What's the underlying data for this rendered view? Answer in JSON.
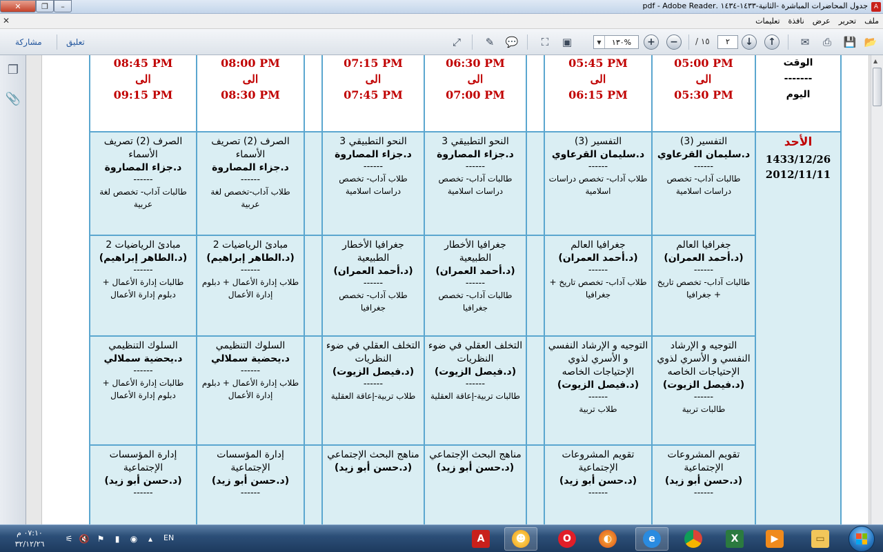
{
  "window": {
    "title": "جدول المحاضرات المباشرة -الثانية-١٤٣٣-١٤٣٤ .pdf - Adobe Reader",
    "pdf_icon": "pdf-icon"
  },
  "menu": {
    "items": [
      "ملف",
      "تحرير",
      "عرض",
      "نافذة",
      "تعليمات"
    ]
  },
  "toolbar": {
    "share_label": "مشاركة",
    "comment_label": "تعليق",
    "page_current": "٢",
    "page_total": "/ ١٥",
    "zoom": "١٣٠%"
  },
  "schedule": {
    "times": [
      {
        "from": "05:00 PM",
        "to_word": "الى",
        "to": "05:30 PM"
      },
      {
        "from": "05:45 PM",
        "to_word": "الى",
        "to": "06:15 PM"
      },
      {
        "from": "06:30 PM",
        "to_word": "الى",
        "to": "07:00 PM"
      },
      {
        "from": "07:15 PM",
        "to_word": "الى",
        "to": "07:45 PM"
      },
      {
        "from": "08:00 PM",
        "to_word": "الى",
        "to": "08:30 PM"
      },
      {
        "from": "08:45 PM",
        "to_word": "الى",
        "to": "09:15 PM"
      }
    ],
    "header_time": "الوقت",
    "header_dash": "-------",
    "header_day": "اليوم",
    "day": {
      "name": "الأحد",
      "hijri": "1433/12/26",
      "gregorian": "2012/11/11"
    },
    "rows": [
      [
        {
          "subject": "التفسير (3)",
          "doctor": "د.سليمان القرعاوي",
          "dash": "------",
          "audience": "طالبات آداب- تخصص دراسات اسلامية"
        },
        {
          "subject": "التفسير (3)",
          "doctor": "د.سليمان القرعاوي",
          "dash": "------",
          "audience": "طلاب آداب- تخصص دراسات اسلامية"
        },
        {
          "subject": "النحو التطبيقي 3",
          "doctor": "د.جزاء المصاروة",
          "dash": "------",
          "audience": "طالبات آداب- تخصص دراسات اسلامية"
        },
        {
          "subject": "النحو التطبيقي 3",
          "doctor": "د.جزاء المصاروة",
          "dash": "------",
          "audience": "طلاب آداب- تخصص دراسات اسلامية"
        },
        {
          "subject": "الصرف (2) تصريف الأسماء",
          "doctor": "د.جزاء المصاروة",
          "dash": "------",
          "audience": "طلاب آداب-تخصص لغة عربية"
        },
        {
          "subject": "الصرف (2) تصريف الأسماء",
          "doctor": "د.جزاء المصاروة",
          "dash": "------",
          "audience": "طالبات آداب- تخصص لغة عربية"
        }
      ],
      [
        {
          "subject": "جغرافيا العالم",
          "doctor": "(د.أحمد العمران)",
          "dash": "------",
          "audience": "طالبات آداب- تخصص تاريخ + جغرافيا"
        },
        {
          "subject": "جغرافيا العالم",
          "doctor": "(د.أحمد العمران)",
          "dash": "------",
          "audience": "طلاب آداب- تخصص تاريخ + جغرافيا"
        },
        {
          "subject": "جغرافيا الأخطار الطبيعية",
          "doctor": "(د.أحمد العمران)",
          "dash": "------",
          "audience": "طالبات آداب- تخصص جغرافيا"
        },
        {
          "subject": "جغرافيا الأخطار الطبيعية",
          "doctor": "(د.أحمد العمران)",
          "dash": "------",
          "audience": "طلاب آداب- تخصص جغرافيا"
        },
        {
          "subject": "مبادئ الرياضيات 2",
          "doctor": "(د.الطاهر إبراهيم)",
          "dash": "------",
          "audience": "طلاب إدارة الأعمال + دبلوم إدارة الأعمال"
        },
        {
          "subject": "مبادئ الرياضيات 2",
          "doctor": "(د.الطاهر إبراهيم)",
          "dash": "------",
          "audience": "طالبات إدارة الأعمال + دبلوم إدارة الأعمال"
        }
      ],
      [
        {
          "subject": "التوجيه و الإرشاد النفسي و الأسري لذوي الإحتياجات الخاصه",
          "doctor": "(د.فيصل الزيوت)",
          "dash": "------",
          "audience": "طالبات تربية"
        },
        {
          "subject": "التوجيه و الإرشاد النفسي و الأسري لذوي الإحتياجات الخاصه",
          "doctor": "(د.فيصل الزيوت)",
          "dash": "------",
          "audience": "طلاب تربية"
        },
        {
          "subject": "التخلف العقلي في ضوء النظريات",
          "doctor": "(د.فيصل الزيوت)",
          "dash": "------",
          "audience": "طالبات تربية-إعاقة العقلية"
        },
        {
          "subject": "التخلف العقلي في ضوء النظريات",
          "doctor": "(د.فيصل الزيوت)",
          "dash": "------",
          "audience": "طلاب تربية-إعاقة العقلية"
        },
        {
          "subject": "السلوك التنظيمي",
          "doctor": "د.يحضية سملالي",
          "dash": "------",
          "audience": "طلاب إدارة الأعمال + دبلوم إدارة الأعمال"
        },
        {
          "subject": "السلوك التنظيمي",
          "doctor": "د.يحضية سملالي",
          "dash": "------",
          "audience": "طالبات إدارة الأعمال + دبلوم إدارة الأعمال"
        }
      ],
      [
        {
          "subject": "تقويم المشروعات الإجتماعية",
          "doctor": "(د.حسن أبو زيد)",
          "dash": "------",
          "audience": ""
        },
        {
          "subject": "تقويم المشروعات الإجتماعية",
          "doctor": "(د.حسن أبو زيد)",
          "dash": "------",
          "audience": ""
        },
        {
          "subject": "مناهج البحث الإجتماعي",
          "doctor": "(د.حسن أبو زيد)",
          "dash": "",
          "audience": ""
        },
        {
          "subject": "مناهج البحث الإجتماعي",
          "doctor": "(د.حسن أبو زيد)",
          "dash": "",
          "audience": ""
        },
        {
          "subject": "إدارة المؤسسات الإجتماعية",
          "doctor": "(د.حسن أبو زيد)",
          "dash": "------",
          "audience": ""
        },
        {
          "subject": "إدارة المؤسسات الإجتماعية",
          "doctor": "(د.حسن أبو زيد)",
          "dash": "------",
          "audience": ""
        }
      ]
    ]
  },
  "taskbar": {
    "time": "٠٧:١٠ م",
    "date": "٣٢/١٢/٢٦",
    "language": "EN",
    "apps": [
      "pdf-reader-icon",
      "messenger-icon",
      "opera-icon",
      "firefox-icon",
      "internet-explorer-icon",
      "chrome-icon",
      "excel-icon",
      "media-player-icon",
      "folder-icon"
    ]
  }
}
